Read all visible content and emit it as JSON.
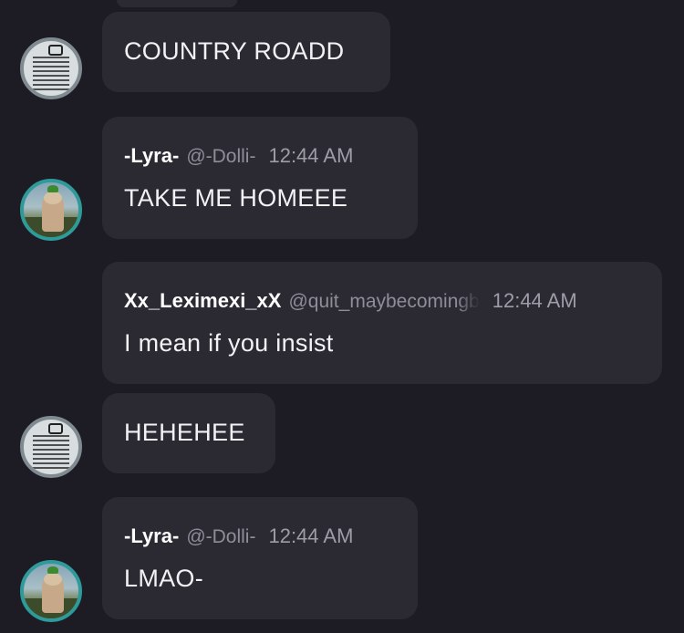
{
  "messages": [
    {
      "author": "",
      "handle": "",
      "time": "",
      "text": "COUNTRY ROADD",
      "avatar": "text-avatar"
    },
    {
      "author": "-Lyra-",
      "handle": "@-Dolli-",
      "time": "12:44 AM",
      "text": "TAKE ME HOMEEE",
      "avatar": "photo-avatar"
    },
    {
      "author": "Xx_Leximexi_xX",
      "handle": "@quit_maybecomingb",
      "time": "12:44 AM",
      "text": "I mean if you insist",
      "avatar": ""
    },
    {
      "author": "",
      "handle": "",
      "time": "",
      "text": "HEHEHEE",
      "avatar": "text-avatar"
    },
    {
      "author": "-Lyra-",
      "handle": "@-Dolli-",
      "time": "12:44 AM",
      "text": "LMAO-",
      "avatar": "photo-avatar"
    }
  ],
  "colors": {
    "background": "#1d1c24",
    "bubble": "#2b2a33",
    "muted": "#8f8e98"
  }
}
